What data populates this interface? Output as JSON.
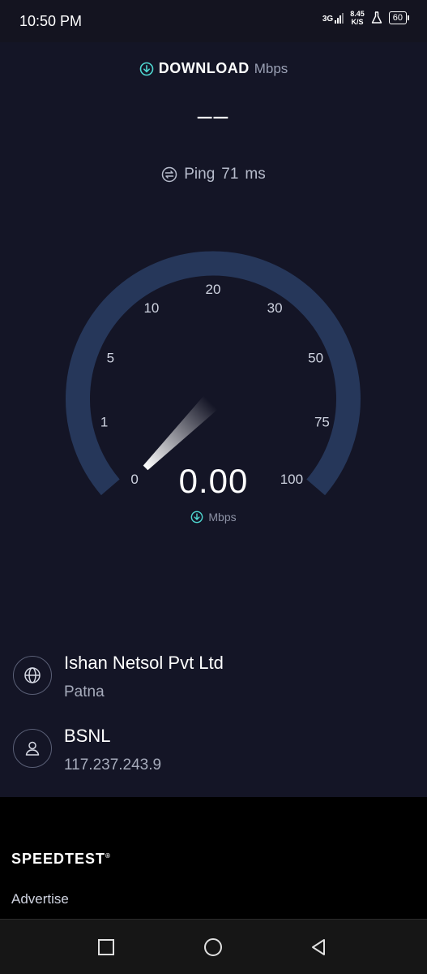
{
  "status_bar": {
    "time": "10:50 PM",
    "network_type": "3G",
    "data_rate_value": "8.45",
    "data_rate_unit": "K/S",
    "battery": "60"
  },
  "test": {
    "title": "DOWNLOAD",
    "unit": "Mbps",
    "value_placeholder": "––",
    "ping_label": "Ping",
    "ping_value": "71",
    "ping_unit": "ms"
  },
  "gauge": {
    "scale_labels": [
      "0",
      "1",
      "5",
      "10",
      "20",
      "30",
      "50",
      "75",
      "100"
    ],
    "current_value": "0.00",
    "current_unit": "Mbps",
    "needle_fraction": 0.0,
    "track_color": "#26375a",
    "needle_color": "#ffffff"
  },
  "server": {
    "name": "Ishan Netsol Pvt Ltd",
    "location": "Patna",
    "icon": "globe-icon"
  },
  "provider": {
    "name": "BSNL",
    "ip": "117.237.243.9",
    "icon": "user-icon"
  },
  "footer": {
    "brand": "SPEEDTEST",
    "brand_mark": "®",
    "link": "Advertise"
  },
  "nav": {
    "recents_icon": "square-icon",
    "home_icon": "circle-icon",
    "back_icon": "triangle-back-icon"
  }
}
